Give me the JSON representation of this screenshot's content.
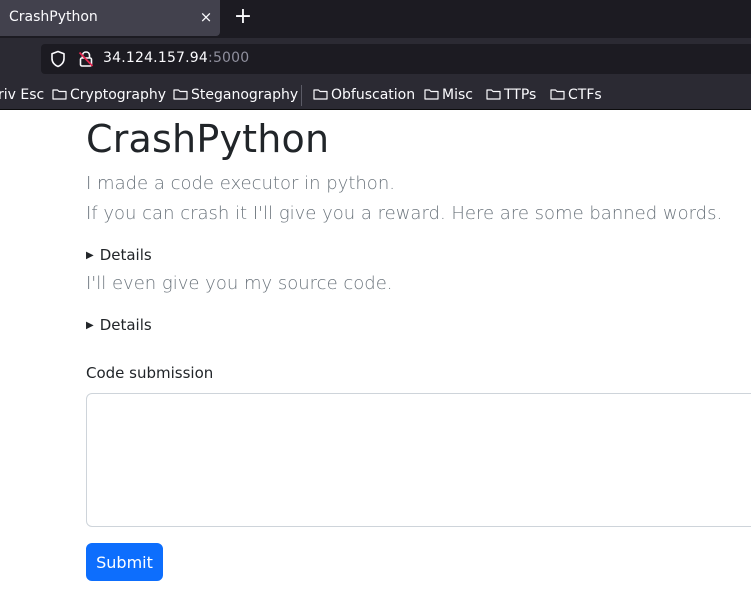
{
  "browser": {
    "tab": {
      "title": "CrashPython",
      "close_glyph": "×"
    },
    "new_tab_glyph": "+",
    "url": {
      "host": "34.124.157.94",
      "port": ":5000"
    },
    "bookmarks": [
      {
        "label": "riv Esc",
        "icon": "none"
      },
      {
        "label": "Cryptography",
        "icon": "folder-icon"
      },
      {
        "label": "Steganography",
        "icon": "folder-icon"
      },
      {
        "label": "Obfuscation",
        "icon": "folder-icon"
      },
      {
        "label": "Misc",
        "icon": "folder-icon"
      },
      {
        "label": "TTPs",
        "icon": "folder-icon"
      },
      {
        "label": "CTFs",
        "icon": "folder-icon"
      }
    ],
    "colors": {
      "tabbar": "#1c1b22",
      "toolbar": "#2b2a33",
      "text": "#fbfbfe"
    }
  },
  "page": {
    "title": "CrashPython",
    "intro_line1": "I made a code executor in python.",
    "intro_line2": "If you can crash it I'll give you a reward. Here are some banned words.",
    "details1_summary": "Details",
    "source_line": "I'll even give you my source code.",
    "details2_summary": "Details",
    "form": {
      "label": "Code submission",
      "code_value": "",
      "submit_label": "Submit"
    },
    "colors": {
      "primary": "#0d6efd",
      "text": "#212529",
      "muted": "#6c757d"
    }
  }
}
